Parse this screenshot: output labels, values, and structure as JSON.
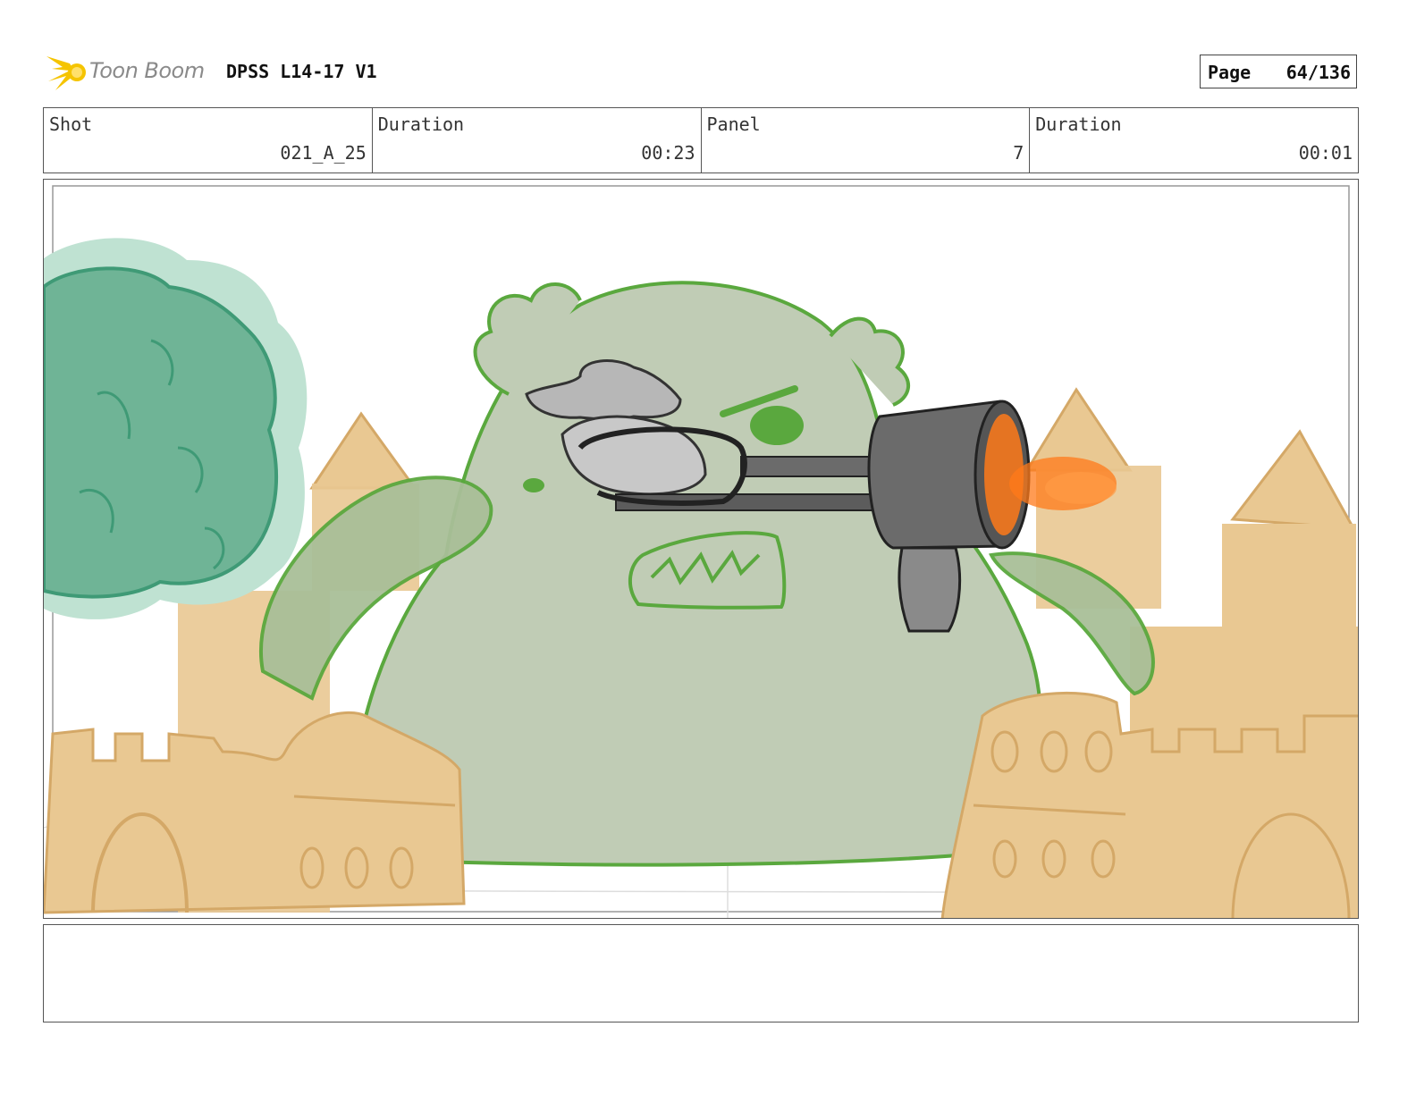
{
  "header": {
    "logo_text": "Toon Boom",
    "document_title": "DPSS L14-17 V1",
    "page_label": "Page",
    "page_value": "64/136"
  },
  "info": {
    "shot_label": "Shot",
    "shot_value": "021_A_25",
    "shot_duration_label": "Duration",
    "shot_duration_value": "00:23",
    "panel_label": "Panel",
    "panel_value": "7",
    "panel_duration_label": "Duration",
    "panel_duration_value": "00:01"
  },
  "colors": {
    "tree": "#6fb496",
    "tree_halo": "#bfe2d2",
    "monster": "#c0ccb5",
    "monster_outline": "#5aa83e",
    "sand": "#e9c892",
    "sand_line": "#d4a867",
    "gun": "#6b6b6b",
    "flash": "#ff7a1a"
  },
  "notes": ""
}
